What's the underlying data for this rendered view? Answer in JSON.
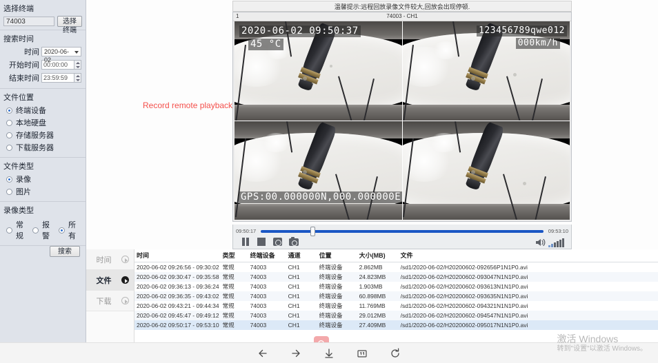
{
  "sidebar": {
    "terminal": {
      "title": "选择终端",
      "value": "74003",
      "button": "选择终端"
    },
    "search_time": {
      "title": "搜索时间",
      "date_label": "时间",
      "date_value": "2020-06-02",
      "start_label": "开始时间",
      "start_value": "00:00:00",
      "end_label": "结束时间",
      "end_value": "23:59:59"
    },
    "file_location": {
      "title": "文件位置",
      "options": [
        "终端设备",
        "本地硬盘",
        "存储服务器",
        "下载服务器"
      ],
      "selected": 0
    },
    "file_type": {
      "title": "文件类型",
      "options": [
        "录像",
        "图片"
      ],
      "selected": 0
    },
    "record_type": {
      "title": "录像类型",
      "options": [
        "常规",
        "报警",
        "所有"
      ],
      "selected": 2
    },
    "search_button": "搜索"
  },
  "banner": {
    "notice": "温馨提示:远程回放录像文件较大,回放会出现停顿."
  },
  "video": {
    "index": "1",
    "channel_title": "74003 - CH1",
    "overlay_timestamp": "2020-06-02 09:50:37",
    "overlay_temperature": "45 °C",
    "overlay_plate": "123456789qwe012",
    "overlay_speed": "000km/h",
    "overlay_gps": "GPS:00.000000N,000.000000E"
  },
  "annotation": {
    "red_label": "Record remote playback"
  },
  "controls": {
    "start_time": "09:50:17",
    "end_time": "09:53:10",
    "progress_percent": 17.5,
    "buttons": [
      "pause",
      "stop",
      "record",
      "snapshot"
    ],
    "volume_level": 5
  },
  "tabs": [
    {
      "label": "时间",
      "active": false
    },
    {
      "label": "文件",
      "active": true
    },
    {
      "label": "下载",
      "active": false
    }
  ],
  "table": {
    "headers": [
      "时间",
      "类型",
      "终端设备",
      "通道",
      "位置",
      "大小(MB)",
      "文件"
    ],
    "rows": [
      [
        "2020-06-02 09:26:56 - 09:30:02",
        "常规",
        "74003",
        "CH1",
        "终端设备",
        "2.862MB",
        "/sd1/2020-06-02/H20200602-092656P1N1P0.avi"
      ],
      [
        "2020-06-02 09:30:47 - 09:35:58",
        "常规",
        "74003",
        "CH1",
        "终端设备",
        "24.823MB",
        "/sd1/2020-06-02/H20200602-093047N1N1P0.avi"
      ],
      [
        "2020-06-02 09:36:13 - 09:36:24",
        "常规",
        "74003",
        "CH1",
        "终端设备",
        "1.903MB",
        "/sd1/2020-06-02/H20200602-093613N1N1P0.avi"
      ],
      [
        "2020-06-02 09:36:35 - 09:43:02",
        "常规",
        "74003",
        "CH1",
        "终端设备",
        "60.898MB",
        "/sd1/2020-06-02/H20200602-093635N1N1P0.avi"
      ],
      [
        "2020-06-02 09:43:21 - 09:44:34",
        "常规",
        "74003",
        "CH1",
        "终端设备",
        "11.769MB",
        "/sd1/2020-06-02/H20200602-094321N1N1P0.avi"
      ],
      [
        "2020-06-02 09:45:47 - 09:49:12",
        "常规",
        "74003",
        "CH1",
        "终端设备",
        "29.012MB",
        "/sd1/2020-06-02/H20200602-094547N1N1P0.avi"
      ],
      [
        "2020-06-02 09:50:17 - 09:53:10",
        "常规",
        "74003",
        "CH1",
        "终端设备",
        "27.409MB",
        "/sd1/2020-06-02/H20200602-095017N1N1P0.avi"
      ]
    ],
    "selected_row": 6
  },
  "bottom_nav": {
    "items": [
      "back-arrow",
      "forward-arrow",
      "download-arrow",
      "one-to-one",
      "refresh"
    ],
    "one_to_one_label": "1:1",
    "search_icon": "search-icon"
  },
  "watermark": {
    "line1": "激活 Windows",
    "line2": "转到\"设置\"以激活 Windows。"
  },
  "colors": {
    "accent": "#1a56c4",
    "alert": "#f4504c",
    "pink": "#f3a9ab",
    "sidebar": "#dfe3ea"
  }
}
